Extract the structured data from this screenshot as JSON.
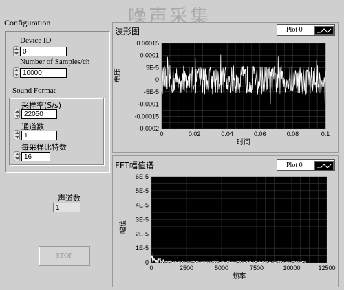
{
  "title": "噪声采集",
  "config": {
    "label": "Configuration",
    "device_id_label": "Device ID",
    "device_id_value": "0",
    "samples_label": "Number of Samples/ch",
    "samples_value": "10000",
    "sound_format_label": "Sound Format",
    "sample_rate_label": "采样率(S/s)",
    "sample_rate_value": "22050",
    "channels_label": "通道数",
    "channels_value": "1",
    "bits_label": "每采样比特数",
    "bits_value": "16"
  },
  "channel_count": {
    "label": "声道数",
    "value": "1"
  },
  "stop_label": "STOP",
  "waveform": {
    "title": "波形图",
    "legend": "Plot 0",
    "xlabel": "时间",
    "ylabel": "电压",
    "yticks": [
      "0.00015",
      "0.0001",
      "5E-5",
      "0",
      "-5E-5",
      "-0.0001",
      "-0.00015",
      "-0.0002"
    ],
    "xticks": [
      "0",
      "0.02",
      "0.04",
      "0.06",
      "0.08",
      "0.1"
    ]
  },
  "fft": {
    "title": "FFT幅值谱",
    "legend": "Plot 0",
    "xlabel": "频率",
    "ylabel": "幅值",
    "yticks": [
      "6E-5",
      "5E-5",
      "4E-5",
      "3E-5",
      "2E-5",
      "1E-5",
      "0"
    ],
    "xticks": [
      "0",
      "2500",
      "5000",
      "7500",
      "10000",
      "12500"
    ]
  },
  "chart_data": [
    {
      "type": "line",
      "title": "波形图",
      "xlabel": "时间",
      "ylabel": "电压",
      "xlim": [
        0,
        0.1
      ],
      "ylim": [
        -0.0002,
        0.00015
      ],
      "grid": true,
      "series": [
        {
          "name": "Plot 0",
          "description": "noise signal ~ ±7E-5, peaks up to ~1E-4",
          "color": "#ffffff"
        }
      ]
    },
    {
      "type": "line",
      "title": "FFT幅值谱",
      "xlabel": "频率",
      "ylabel": "幅值",
      "xlim": [
        0,
        12500
      ],
      "ylim": [
        0,
        6e-05
      ],
      "grid": true,
      "series": [
        {
          "name": "Plot 0",
          "color": "#ffffff"
        }
      ]
    }
  ]
}
